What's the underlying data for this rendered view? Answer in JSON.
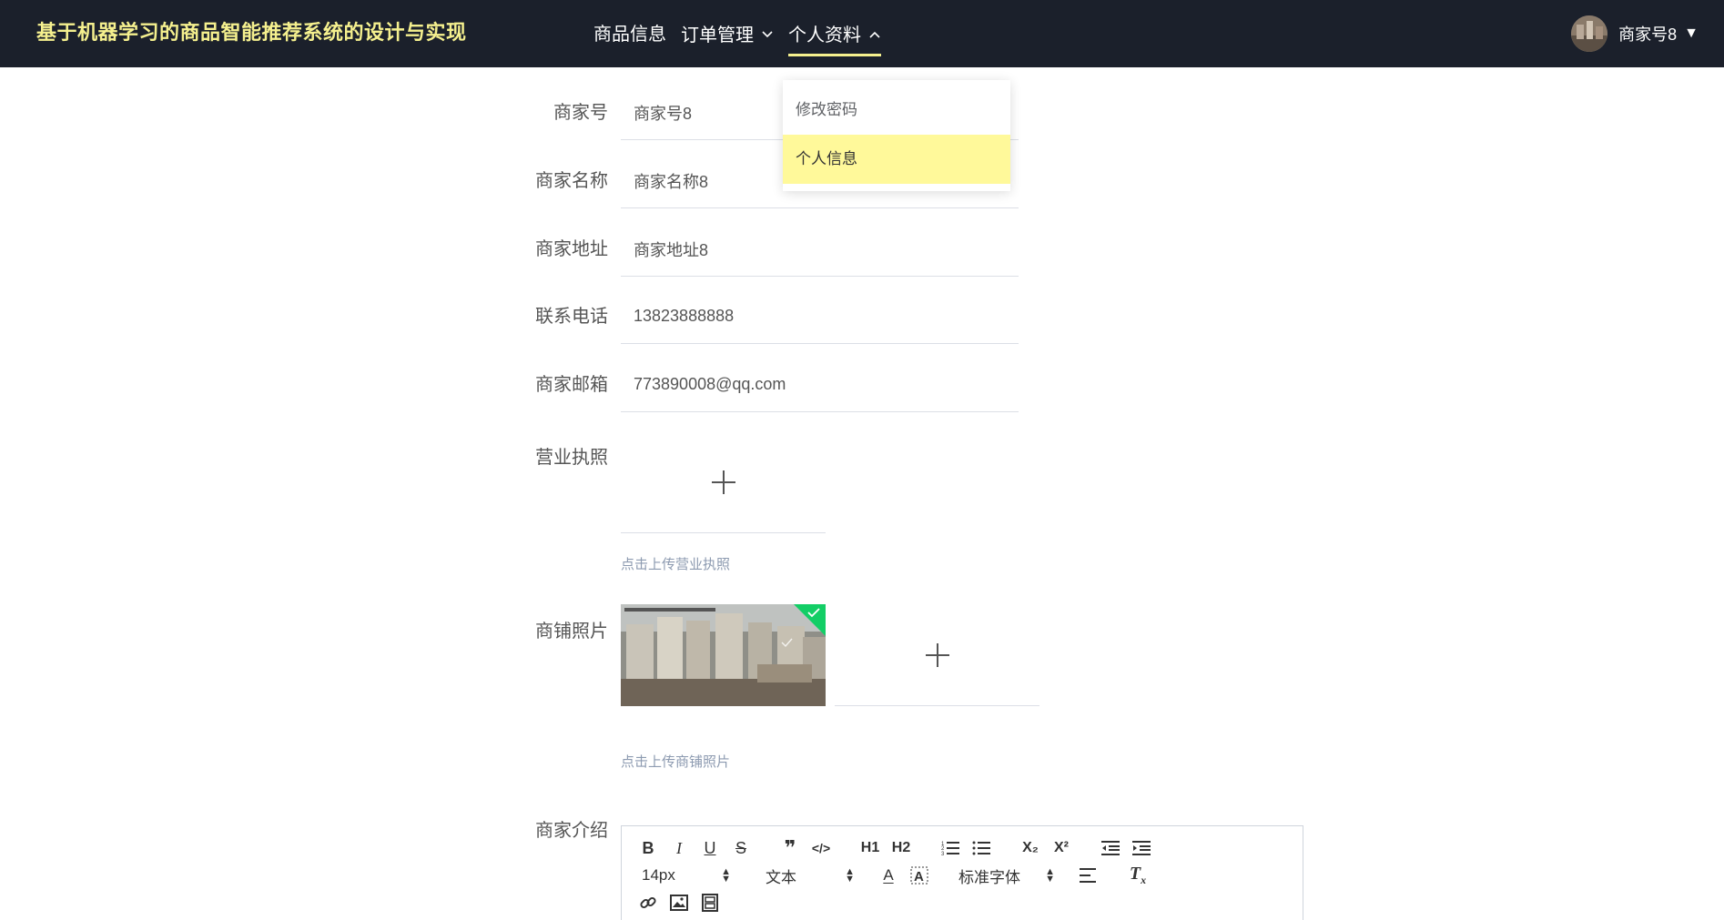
{
  "header": {
    "title": "基于机器学习的商品智能推荐系统的设计与实现",
    "nav": [
      {
        "label": "商品信息",
        "has_chevron": false
      },
      {
        "label": "订单管理",
        "has_chevron": true,
        "chevron": "chevron-down"
      },
      {
        "label": "个人资料",
        "has_chevron": true,
        "chevron": "chevron-up",
        "active": true
      }
    ],
    "user_name": "商家号8",
    "user_caret": "▼"
  },
  "dropdown": {
    "items": [
      "修改密码",
      "个人信息"
    ],
    "highlighted": "个人信息"
  },
  "form": {
    "fields": [
      {
        "label": "商家号",
        "value": "商家号8"
      },
      {
        "label": "商家名称",
        "value": "商家名称8"
      },
      {
        "label": "商家地址",
        "value": "商家地址8"
      },
      {
        "label": "联系电话",
        "value": "13823888888"
      },
      {
        "label": "商家邮箱",
        "value": "773890008@qq.com"
      }
    ],
    "license_label": "营业执照",
    "license_hint": "点击上传营业执照",
    "shop_photo_label": "商铺照片",
    "shop_photo_hint": "点击上传商铺照片",
    "intro_label": "商家介绍"
  },
  "editor": {
    "font_size": "14px",
    "block_format": "文本",
    "font_family": "标准字体",
    "buttons_row1": [
      "B",
      "I",
      "U",
      "S",
      "❞",
      "</>",
      "H1",
      "H2",
      "ordered-list",
      "bullet-list",
      "X₂",
      "X²",
      "outdent",
      "indent"
    ],
    "color_text": "A"
  },
  "colors": {
    "header_bg": "#1b202b",
    "accent": "#f5f08e",
    "dropdown_highlight": "#fff99a",
    "success": "#13ce66"
  }
}
